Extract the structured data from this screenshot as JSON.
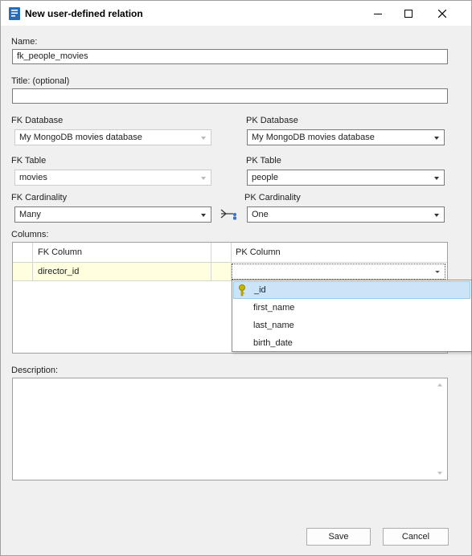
{
  "window": {
    "title": "New user-defined relation"
  },
  "name": {
    "label": "Name:",
    "value": "fk_people_movies"
  },
  "title_field": {
    "label": "Title: (optional)",
    "value": ""
  },
  "fk_database": {
    "label": "FK Database",
    "value": "My MongoDB movies database"
  },
  "pk_database": {
    "label": "PK Database",
    "value": "My MongoDB movies database"
  },
  "fk_table": {
    "label": "FK Table",
    "value": "movies"
  },
  "pk_table": {
    "label": "PK Table",
    "value": "people"
  },
  "fk_cardinality": {
    "label": "FK Cardinality",
    "value": "Many"
  },
  "pk_cardinality": {
    "label": "PK Cardinality",
    "value": "One"
  },
  "columns": {
    "label": "Columns:",
    "headers": [
      "FK Column",
      "PK Column"
    ],
    "rows": [
      {
        "fk": "director_id",
        "pk": ""
      }
    ]
  },
  "pk_dropdown": {
    "options": [
      "_id",
      "first_name",
      "last_name",
      "birth_date"
    ],
    "selected": "_id"
  },
  "description": {
    "label": "Description:",
    "value": ""
  },
  "buttons": {
    "save": "Save",
    "cancel": "Cancel"
  },
  "colors": {
    "row_highlight": "#ffffe0",
    "selection": "#cce4f7",
    "key_icon": "#c8b400"
  }
}
